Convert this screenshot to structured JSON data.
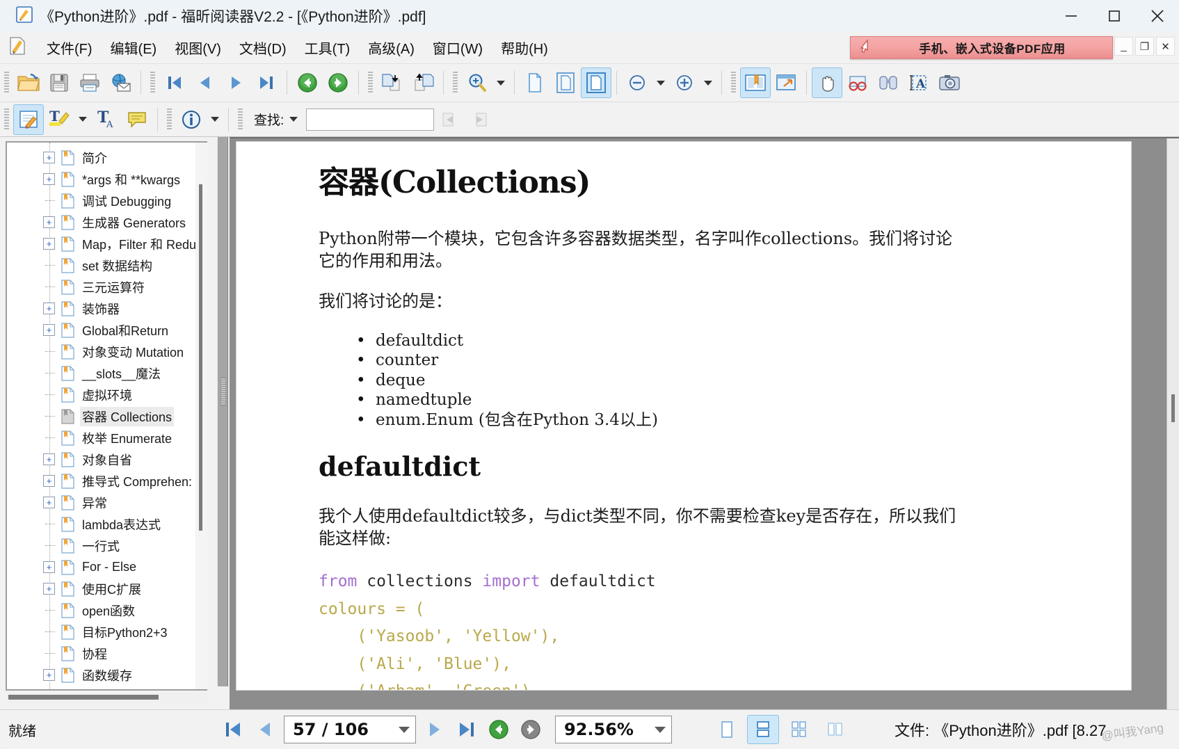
{
  "window": {
    "title": "《Python进阶》.pdf - 福昕阅读器V2.2 - [《Python进阶》.pdf]",
    "minimize_label": "—",
    "maximize_label": "□",
    "close_label": "✕",
    "mdi_minimize_label": "_",
    "mdi_restore_label": "❐",
    "mdi_close_label": "✕"
  },
  "menu": {
    "items": [
      {
        "label": "文件(F)",
        "accel": "F"
      },
      {
        "label": "编辑(E)",
        "accel": "E"
      },
      {
        "label": "视图(V)",
        "accel": "V"
      },
      {
        "label": "文档(D)",
        "accel": "D"
      },
      {
        "label": "工具(T)",
        "accel": "T"
      },
      {
        "label": "高级(A)",
        "accel": "A"
      },
      {
        "label": "窗口(W)",
        "accel": "W"
      },
      {
        "label": "帮助(H)",
        "accel": "H"
      }
    ],
    "ad_text": "手机、嵌入式设备PDF应用"
  },
  "toolbar1": {
    "buttons": [
      {
        "name": "open-file-button",
        "icon": "open-folder-icon"
      },
      {
        "name": "save-button",
        "icon": "save-floppy-icon"
      },
      {
        "name": "print-button",
        "icon": "printer-icon"
      },
      {
        "name": "email-button",
        "icon": "email-globe-icon"
      },
      {
        "name": "first-page-button",
        "icon": "first-page-icon"
      },
      {
        "name": "previous-page-button",
        "icon": "previous-page-icon"
      },
      {
        "name": "next-page-button",
        "icon": "next-page-icon"
      },
      {
        "name": "last-page-button",
        "icon": "last-page-icon"
      },
      {
        "name": "go-back-button",
        "icon": "back-circle-icon"
      },
      {
        "name": "go-forward-button",
        "icon": "forward-circle-icon"
      },
      {
        "name": "rotate-clockwise-button",
        "icon": "rotate-cw-icon"
      },
      {
        "name": "rotate-counterclockwise-button",
        "icon": "rotate-ccw-icon"
      },
      {
        "name": "zoom-tool-button",
        "icon": "magnifier-plus-icon"
      },
      {
        "name": "actual-size-button",
        "icon": "page-actual-size-icon"
      },
      {
        "name": "fit-page-button",
        "icon": "page-fit-icon"
      },
      {
        "name": "fit-width-button",
        "icon": "page-fit-width-icon"
      },
      {
        "name": "zoom-out-button",
        "icon": "zoom-out-icon"
      },
      {
        "name": "zoom-in-button",
        "icon": "zoom-in-icon"
      },
      {
        "name": "bookmark-panel-button",
        "icon": "bookmark-book-icon"
      },
      {
        "name": "full-screen-button",
        "icon": "fullscreen-icon"
      },
      {
        "name": "hand-tool-button",
        "icon": "hand-icon"
      },
      {
        "name": "read-mode-button",
        "icon": "glasses-icon"
      },
      {
        "name": "find-button",
        "icon": "binoculars-icon"
      },
      {
        "name": "select-text-button",
        "icon": "select-text-icon"
      },
      {
        "name": "snapshot-button",
        "icon": "camera-icon"
      }
    ]
  },
  "toolbar2": {
    "buttons": [
      {
        "name": "edit-annotate-button",
        "icon": "notepad-pencil-icon"
      },
      {
        "name": "highlight-button",
        "icon": "highlighter-icon"
      },
      {
        "name": "text-tool-button",
        "icon": "text-tool-icon"
      },
      {
        "name": "comment-button",
        "icon": "comment-bubble-icon"
      },
      {
        "name": "document-info-button",
        "icon": "info-circle-icon"
      }
    ],
    "find_label": "查找:",
    "find_value": "",
    "find_placeholder": ""
  },
  "sidebar": {
    "items": [
      {
        "label": "简介",
        "expandable": true,
        "selected": false
      },
      {
        "label": "*args 和 **kwargs",
        "expandable": true,
        "selected": false
      },
      {
        "label": "调试 Debugging",
        "expandable": false,
        "selected": false
      },
      {
        "label": "生成器 Generators",
        "expandable": true,
        "selected": false
      },
      {
        "label": "Map，Filter 和 Redu",
        "expandable": true,
        "selected": false
      },
      {
        "label": "set 数据结构",
        "expandable": false,
        "selected": false
      },
      {
        "label": "三元运算符",
        "expandable": false,
        "selected": false
      },
      {
        "label": "装饰器",
        "expandable": true,
        "selected": false
      },
      {
        "label": "Global和Return",
        "expandable": true,
        "selected": false
      },
      {
        "label": "对象变动 Mutation",
        "expandable": false,
        "selected": false
      },
      {
        "label": "__slots__魔法",
        "expandable": false,
        "selected": false
      },
      {
        "label": "虚拟环境",
        "expandable": false,
        "selected": false
      },
      {
        "label": "容器 Collections",
        "expandable": false,
        "selected": true
      },
      {
        "label": "枚举 Enumerate",
        "expandable": false,
        "selected": false
      },
      {
        "label": "对象自省",
        "expandable": true,
        "selected": false
      },
      {
        "label": "推导式 Comprehen:",
        "expandable": true,
        "selected": false
      },
      {
        "label": "异常",
        "expandable": true,
        "selected": false
      },
      {
        "label": "lambda表达式",
        "expandable": false,
        "selected": false
      },
      {
        "label": "一行式",
        "expandable": false,
        "selected": false
      },
      {
        "label": "For - Else",
        "expandable": true,
        "selected": false
      },
      {
        "label": "使用C扩展",
        "expandable": true,
        "selected": false
      },
      {
        "label": "open函数",
        "expandable": false,
        "selected": false
      },
      {
        "label": "目标Python2+3",
        "expandable": false,
        "selected": false
      },
      {
        "label": "协程",
        "expandable": false,
        "selected": false
      },
      {
        "label": "函数缓存",
        "expandable": true,
        "selected": false
      }
    ]
  },
  "document": {
    "heading": "容器(Collections)",
    "paragraph1": "Python附带一个模块，它包含许多容器数据类型，名字叫作collections。我们将讨论它的作用和用法。",
    "paragraph2": "我们将讨论的是：",
    "bullets": [
      "defaultdict",
      "counter",
      "deque",
      "namedtuple",
      "enum.Enum (包含在Python 3.4以上)"
    ],
    "subheading": "defaultdict",
    "paragraph3": "我个人使用defaultdict较多，与dict类型不同，你不需要检查key是否存在，所以我们能这样做:",
    "code_line1_kw1": "from",
    "code_line1_mid": " collections ",
    "code_line1_kw2": "import",
    "code_line1_end": " defaultdict",
    "code_rest": "\ncolours = (\n    ('Yasoob', 'Yellow'),\n    ('Ali', 'Blue'),\n    ('Arham', 'Green'),"
  },
  "statusbar": {
    "ready_label": "就绪",
    "page_value": "57 / 106",
    "zoom_value": "92.56%",
    "file_label": "文件: 《Python进阶》.pdf [8.27",
    "watermark": "@叫我Yang",
    "view_modes": [
      {
        "name": "single-page-view",
        "active": false
      },
      {
        "name": "continuous-page-view",
        "active": true
      },
      {
        "name": "facing-grid-view",
        "active": false
      },
      {
        "name": "two-page-view",
        "active": false
      }
    ]
  }
}
